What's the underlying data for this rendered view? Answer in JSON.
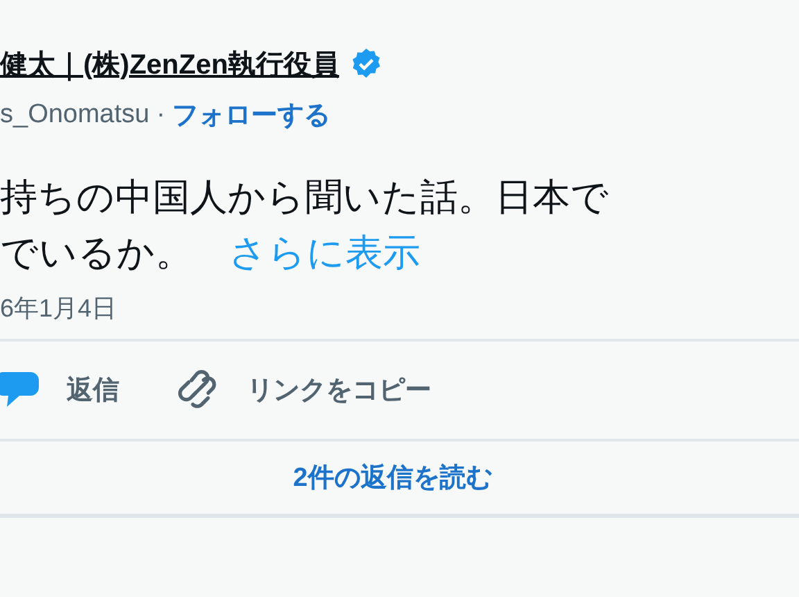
{
  "author": {
    "name": "健太｜(株)ZenZen執行役員",
    "verified": true,
    "handle": "s_Onomatsu",
    "separator": "·",
    "follow": "フォローする"
  },
  "body": {
    "lines": [
      "持ちの中国人から聞いた話。日本で",
      "でいるか。"
    ],
    "more": "さらに表示"
  },
  "date": "6年1月4日",
  "actions": [
    {
      "kind": "reply",
      "label": "返信"
    },
    {
      "kind": "link",
      "label": "リンクをコピー"
    }
  ],
  "replies_link": "2件の返信を読む"
}
